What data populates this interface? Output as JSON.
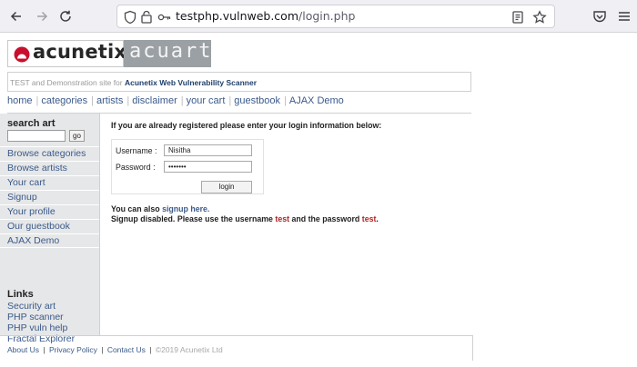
{
  "browser": {
    "url_host": "testphp.vulnweb.com",
    "url_path": "/login.php",
    "icons": [
      "back-arrow-icon",
      "forward-arrow-icon",
      "reload-icon",
      "shield-icon",
      "tracking-icon",
      "key-icon",
      "reader-view-icon",
      "bookmark-star-icon",
      "pocket-icon",
      "menu-icon"
    ]
  },
  "brand": {
    "left": "acunetix",
    "right": "acuart",
    "accent": "#c8102e"
  },
  "tagline": {
    "prefix": "TEST and Demonstration site for",
    "strong": "Acunetix Web Vulnerability Scanner"
  },
  "menu": [
    "home",
    "categories",
    "artists",
    "disclaimer",
    "your cart",
    "guestbook",
    "AJAX Demo"
  ],
  "sidebar": {
    "search_title": "search art",
    "search_value": "",
    "go_label": "go",
    "items": [
      "Browse categories",
      "Browse artists",
      "Your cart",
      "Signup",
      "Your profile",
      "Our guestbook",
      "AJAX Demo"
    ],
    "links_title": "Links",
    "links": [
      "Security art",
      "PHP scanner",
      "PHP vuln help",
      "Fractal Explorer"
    ]
  },
  "login": {
    "intro": "If you are already registered please enter your login information below:",
    "username_label": "Username :",
    "username_value": "Nisitha",
    "password_label": "Password :",
    "password_value": "•••••••",
    "button": "login",
    "signup_prefix": "You can also",
    "signup_link": "signup here.",
    "disabled_text": "Signup disabled. Please use the username",
    "disabled_user": "test",
    "disabled_mid": "and the password",
    "disabled_pass": "test",
    "disabled_end": "."
  },
  "footer": {
    "about": "About Us",
    "privacy": "Privacy Policy",
    "contact": "Contact Us",
    "copyright": "©2019 Acunetix Ltd"
  }
}
